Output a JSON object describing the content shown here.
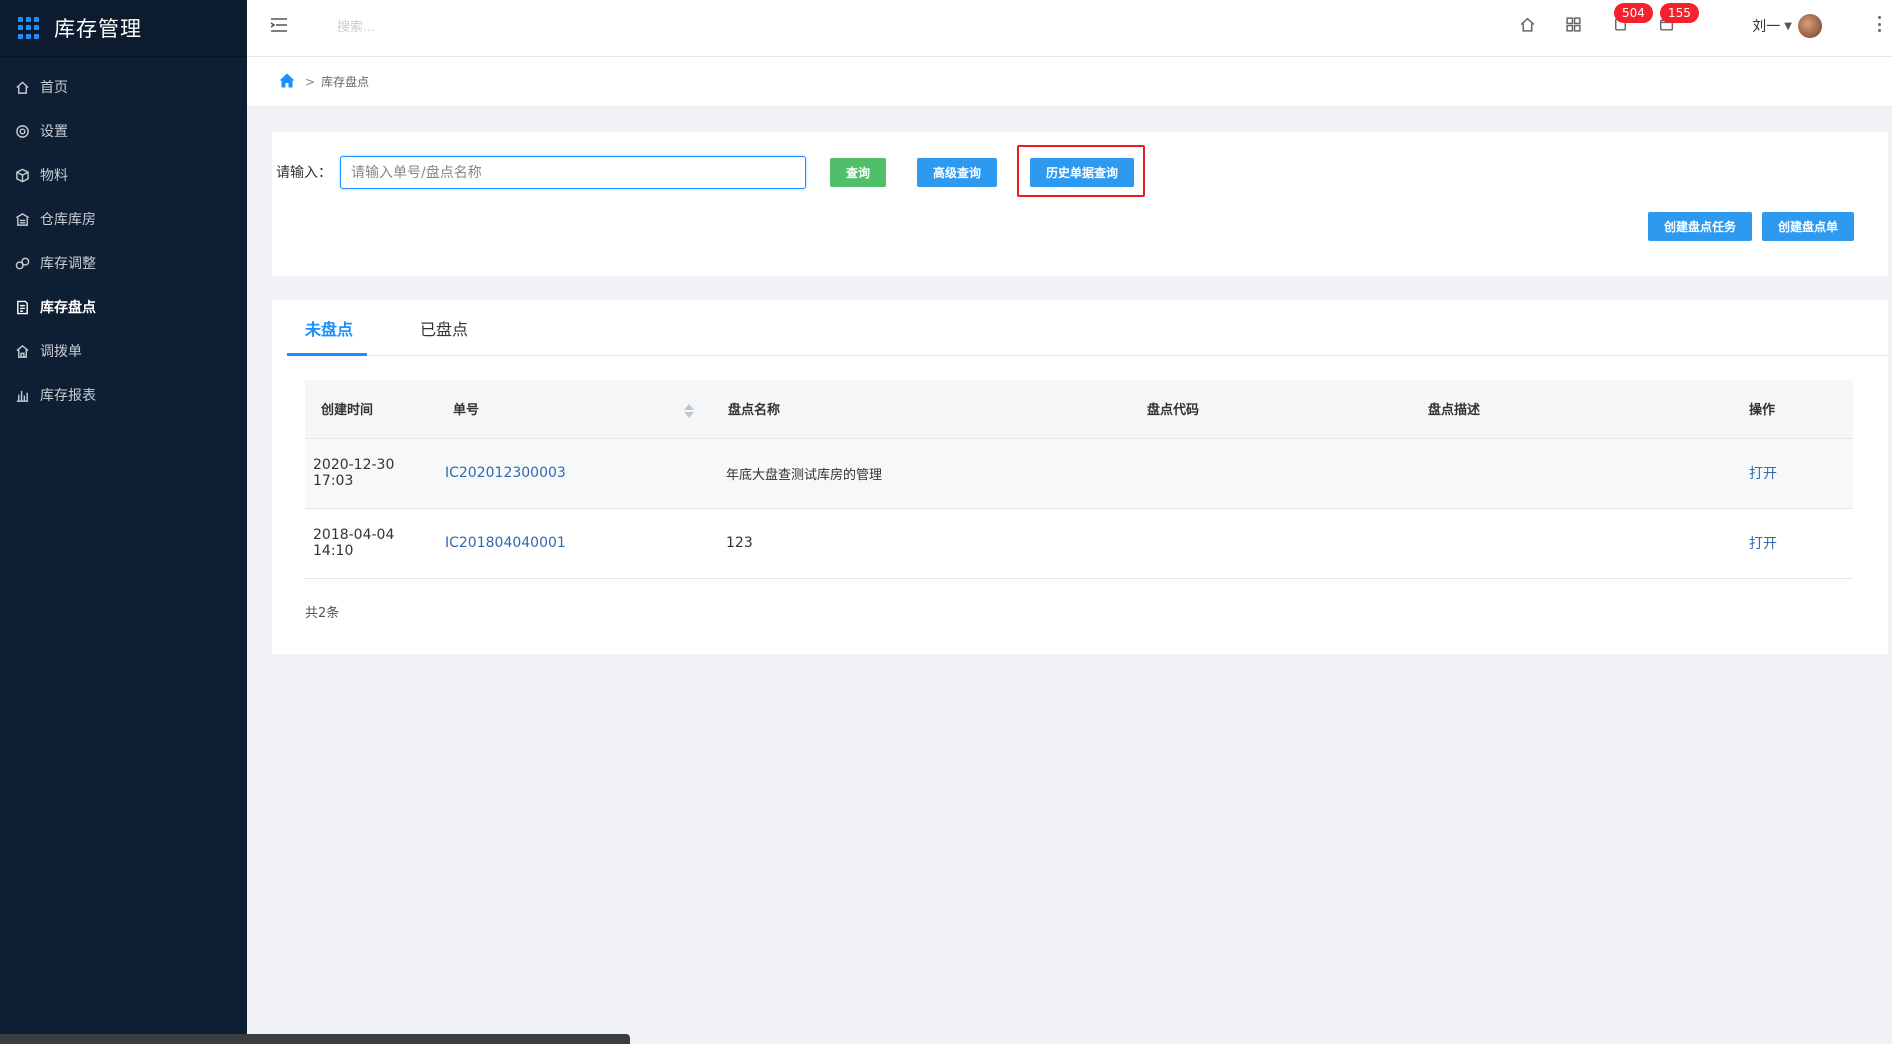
{
  "app": {
    "title": "库存管理"
  },
  "sidebar": {
    "items": [
      {
        "label": "首页",
        "icon": "home-icon"
      },
      {
        "label": "设置",
        "icon": "gear-icon"
      },
      {
        "label": "物料",
        "icon": "box-icon"
      },
      {
        "label": "仓库库房",
        "icon": "warehouse-icon"
      },
      {
        "label": "库存调整",
        "icon": "adjust-icon"
      },
      {
        "label": "库存盘点",
        "icon": "inventory-check-icon",
        "active": true
      },
      {
        "label": "调拨单",
        "icon": "transfer-icon"
      },
      {
        "label": "库存报表",
        "icon": "bar-chart-icon"
      }
    ]
  },
  "header": {
    "search_placeholder": "搜索...",
    "notifications_count": "504",
    "messages_count": "155",
    "user_name": "刘一"
  },
  "breadcrumb": {
    "current": "库存盘点",
    "separator": ">"
  },
  "search_panel": {
    "label": "请输入：",
    "input_placeholder": "请输入单号/盘点名称",
    "query_button": "查询",
    "advanced_button": "高级查询",
    "history_button": "历史单据查询",
    "create_task_button": "创建盘点任务",
    "create_sheet_button": "创建盘点单"
  },
  "tabs": [
    {
      "label": "未盘点",
      "active": true
    },
    {
      "label": "已盘点"
    }
  ],
  "table": {
    "columns": [
      "创建时间",
      "单号",
      "盘点名称",
      "盘点代码",
      "盘点描述",
      "操作"
    ],
    "rows": [
      {
        "date": "2020-12-30",
        "time": "17:03",
        "number": "IC202012300003",
        "name": "年底大盘查测试库房的管理",
        "code": "",
        "desc": "",
        "action": "打开"
      },
      {
        "date": "2018-04-04",
        "time": "14:10",
        "number": "IC201804040001",
        "name": "123",
        "code": "",
        "desc": "",
        "action": "打开"
      }
    ],
    "total": "共2条"
  },
  "colors": {
    "sidebar": "#0f1f33",
    "accent": "#1890ff",
    "green": "#4fbf6a",
    "badge": "#f5222d",
    "highlight": "#ee1c1c"
  }
}
